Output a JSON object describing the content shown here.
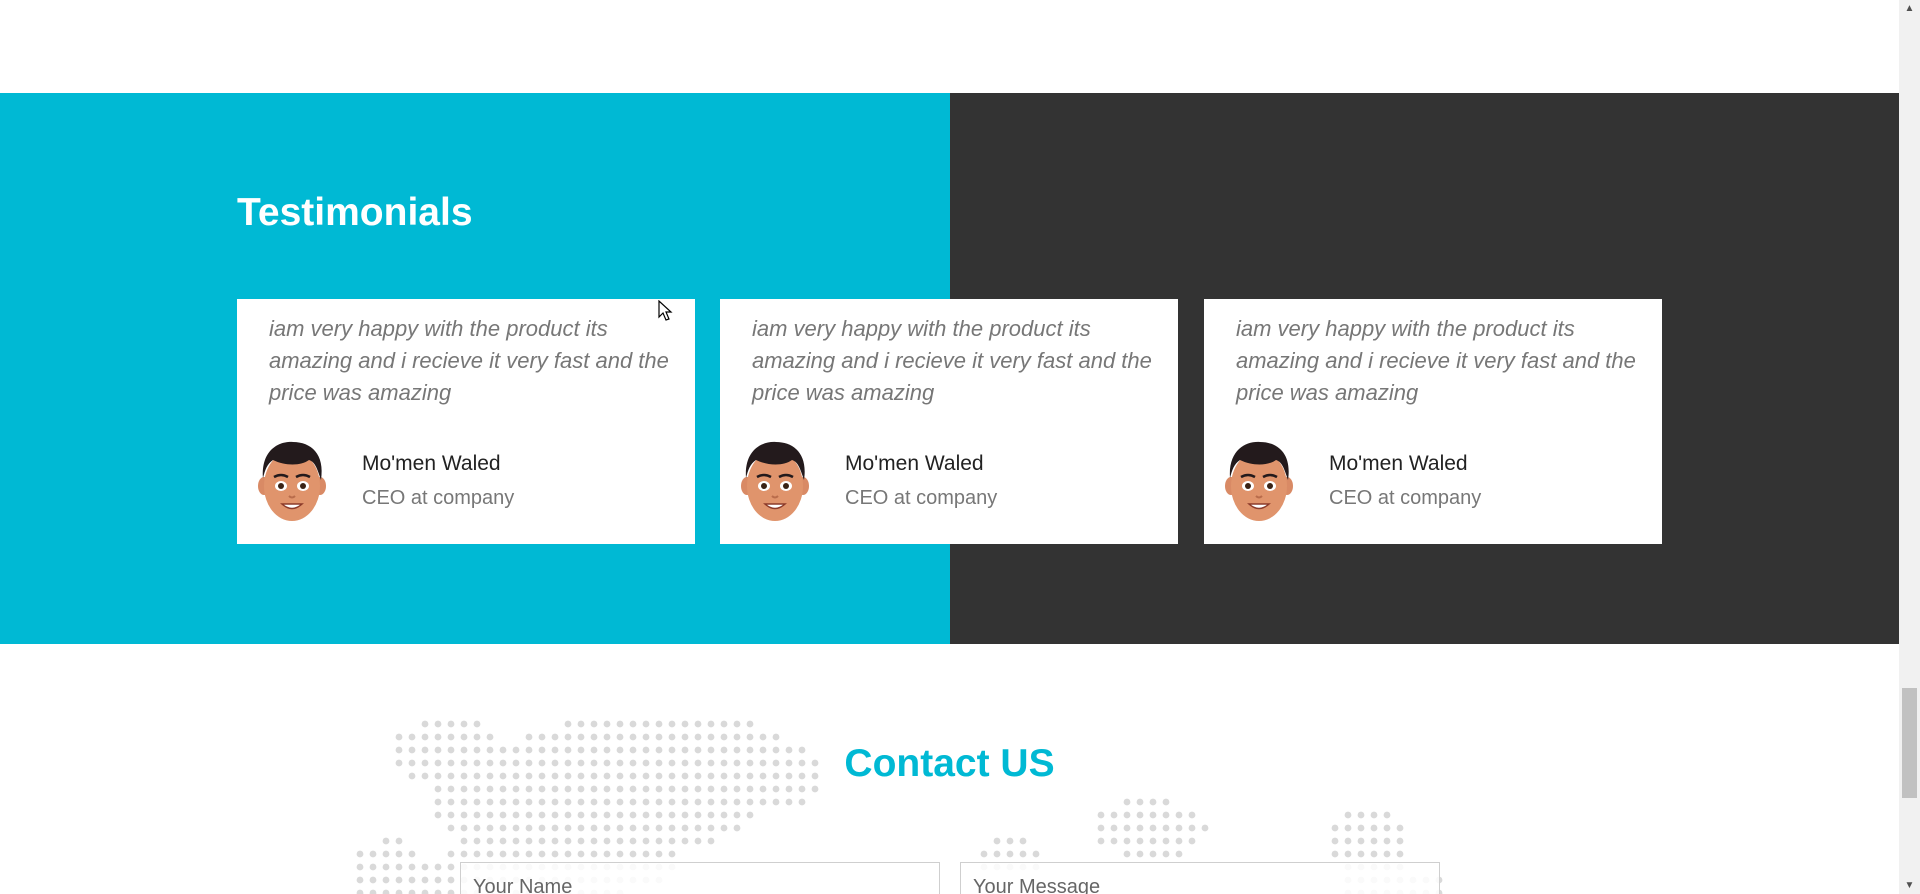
{
  "testimonials": {
    "title": "Testimonials",
    "colors": {
      "left_bg": "#00b9d4",
      "right_bg": "#333333"
    },
    "cards": [
      {
        "quote": "iam very happy with the product its amazing and i recieve it very fast and the price was amazing",
        "name": "Mo'men Waled",
        "role": "CEO at company",
        "avatar_icon": "person-avatar-icon"
      },
      {
        "quote": "iam very happy with the product its amazing and i recieve it very fast and the price was amazing",
        "name": "Mo'men Waled",
        "role": "CEO at company",
        "avatar_icon": "person-avatar-icon"
      },
      {
        "quote": "iam very happy with the product its amazing and i recieve it very fast and the price was amazing",
        "name": "Mo'men Waled",
        "role": "CEO at company",
        "avatar_icon": "person-avatar-icon"
      }
    ]
  },
  "contact": {
    "title": "Contact US",
    "accent": "#00b9d4",
    "name_placeholder": "Your Name",
    "message_placeholder": "Your Message",
    "background_icon": "world-map-dots"
  }
}
